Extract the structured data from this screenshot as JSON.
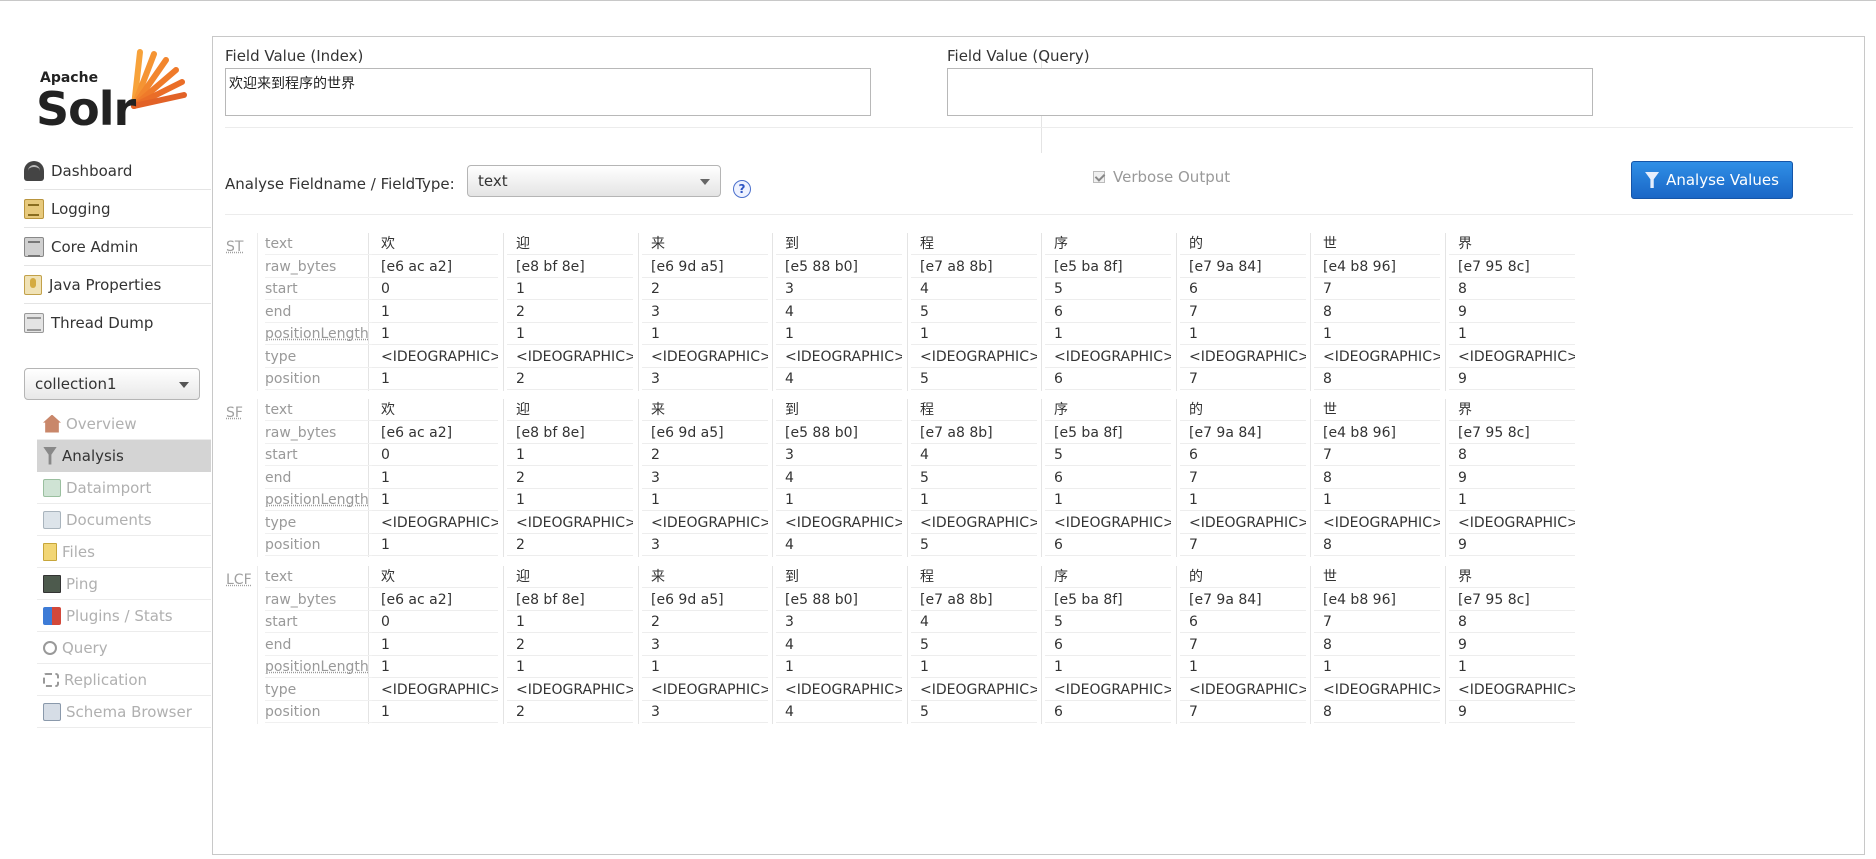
{
  "logo": {
    "apache": "Apache",
    "solr": "Solr"
  },
  "nav": [
    {
      "label": "Dashboard",
      "icon": "dashboard-icon"
    },
    {
      "label": "Logging",
      "icon": "logging-icon"
    },
    {
      "label": "Core Admin",
      "icon": "core-admin-icon"
    },
    {
      "label": "Java Properties",
      "icon": "java-properties-icon"
    },
    {
      "label": "Thread Dump",
      "icon": "thread-dump-icon"
    }
  ],
  "core_selector": {
    "value": "collection1"
  },
  "core_nav": [
    {
      "label": "Overview",
      "icon": "overview-icon",
      "active": false
    },
    {
      "label": "Analysis",
      "icon": "analysis-icon",
      "active": true
    },
    {
      "label": "Dataimport",
      "icon": "dataimport-icon",
      "active": false
    },
    {
      "label": "Documents",
      "icon": "documents-icon",
      "active": false
    },
    {
      "label": "Files",
      "icon": "files-icon",
      "active": false
    },
    {
      "label": "Ping",
      "icon": "ping-icon",
      "active": false
    },
    {
      "label": "Plugins / Stats",
      "icon": "plugins-icon",
      "active": false
    },
    {
      "label": "Query",
      "icon": "query-icon",
      "active": false
    },
    {
      "label": "Replication",
      "icon": "replication-icon",
      "active": false
    },
    {
      "label": "Schema Browser",
      "icon": "schema-browser-icon",
      "active": false
    }
  ],
  "analysis": {
    "index_label": "Field Value (Index)",
    "index_value": "欢迎来到程序的世界",
    "query_label": "Field Value (Query)",
    "query_value": "",
    "fieldname_label": "Analyse Fieldname / FieldType:",
    "fieldtype_value": "text",
    "help": "?",
    "verbose_label": "Verbose Output",
    "verbose_checked": true,
    "analyse_button": "Analyse Values"
  },
  "row_labels": [
    "text",
    "raw_bytes",
    "start",
    "end",
    "positionLength",
    "type",
    "position"
  ],
  "tokens": [
    {
      "text": "欢",
      "raw_bytes": "[e6 ac a2]",
      "start": "0",
      "end": "1",
      "positionLength": "1",
      "type": "<IDEOGRAPHIC>",
      "position": "1"
    },
    {
      "text": "迎",
      "raw_bytes": "[e8 bf 8e]",
      "start": "1",
      "end": "2",
      "positionLength": "1",
      "type": "<IDEOGRAPHIC>",
      "position": "2"
    },
    {
      "text": "来",
      "raw_bytes": "[e6 9d a5]",
      "start": "2",
      "end": "3",
      "positionLength": "1",
      "type": "<IDEOGRAPHIC>",
      "position": "3"
    },
    {
      "text": "到",
      "raw_bytes": "[e5 88 b0]",
      "start": "3",
      "end": "4",
      "positionLength": "1",
      "type": "<IDEOGRAPHIC>",
      "position": "4"
    },
    {
      "text": "程",
      "raw_bytes": "[e7 a8 8b]",
      "start": "4",
      "end": "5",
      "positionLength": "1",
      "type": "<IDEOGRAPHIC>",
      "position": "5"
    },
    {
      "text": "序",
      "raw_bytes": "[e5 ba 8f]",
      "start": "5",
      "end": "6",
      "positionLength": "1",
      "type": "<IDEOGRAPHIC>",
      "position": "6"
    },
    {
      "text": "的",
      "raw_bytes": "[e7 9a 84]",
      "start": "6",
      "end": "7",
      "positionLength": "1",
      "type": "<IDEOGRAPHIC>",
      "position": "7"
    },
    {
      "text": "世",
      "raw_bytes": "[e4 b8 96]",
      "start": "7",
      "end": "8",
      "positionLength": "1",
      "type": "<IDEOGRAPHIC>",
      "position": "8"
    },
    {
      "text": "界",
      "raw_bytes": "[e7 95 8c]",
      "start": "8",
      "end": "9",
      "positionLength": "1",
      "type": "<IDEOGRAPHIC>",
      "position": "9"
    }
  ],
  "stages": [
    {
      "name": "ST"
    },
    {
      "name": "SF"
    },
    {
      "name": "LCF"
    }
  ],
  "colors": {
    "accent": "#1a66c6",
    "active_nav": "#d4d4d4",
    "logo_orange": "#f07b2a"
  }
}
